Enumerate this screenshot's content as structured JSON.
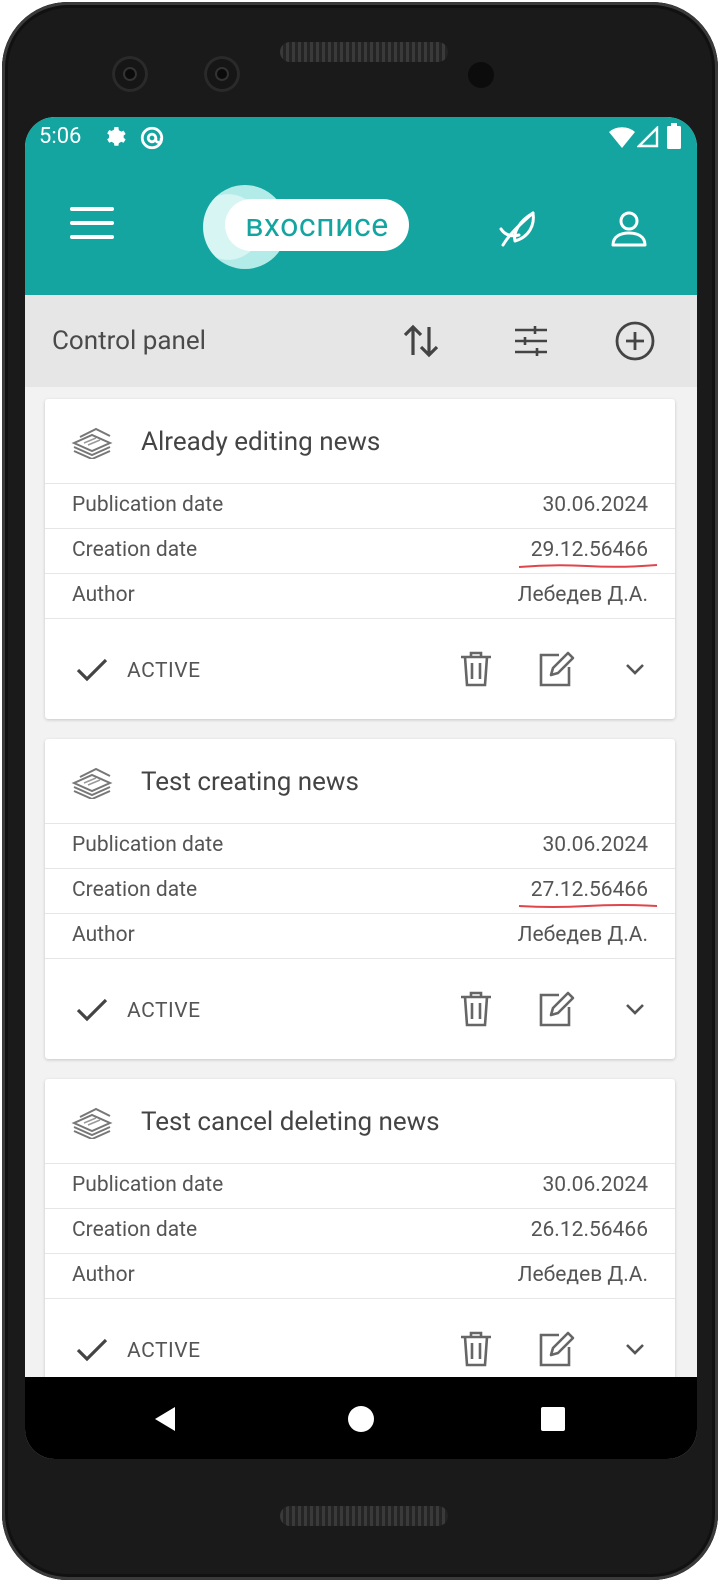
{
  "status_bar": {
    "time": "5:06",
    "left_icons": [
      "gear-icon",
      "at-sign-icon"
    ],
    "right_icons": [
      "wifi-icon",
      "signal-icon",
      "battery-icon"
    ]
  },
  "app_bar": {
    "logo_text": "вхосписе",
    "icons": [
      "menu-icon",
      "leaf-icon",
      "user-icon"
    ],
    "accent_color": "#14a5a1"
  },
  "toolbar": {
    "title": "Control panel",
    "icons": [
      "sort-icon",
      "filter-icon",
      "add-circle-icon"
    ]
  },
  "news": [
    {
      "title": "Already editing news",
      "rows": [
        {
          "label": "Publication date",
          "value": "30.06.2024"
        },
        {
          "label": "Creation date",
          "value": "29.12.56466"
        },
        {
          "label": "Author",
          "value": "Лебедев Д.А."
        }
      ],
      "status": "ACTIVE"
    },
    {
      "title": "Test creating news",
      "rows": [
        {
          "label": "Publication date",
          "value": "30.06.2024"
        },
        {
          "label": "Creation date",
          "value": "27.12.56466"
        },
        {
          "label": "Author",
          "value": "Лебедев Д.А."
        }
      ],
      "status": "ACTIVE"
    },
    {
      "title": "Test cancel deleting news",
      "rows": [
        {
          "label": "Publication date",
          "value": "30.06.2024"
        },
        {
          "label": "Creation date",
          "value": "26.12.56466"
        },
        {
          "label": "Author",
          "value": "Лебедев Д.А."
        }
      ],
      "status": "ACTIVE"
    }
  ],
  "card_actions": [
    "trash-icon",
    "edit-icon",
    "chevron-down-icon"
  ],
  "nav_bar": [
    "back-icon",
    "home-icon",
    "recents-icon"
  ]
}
